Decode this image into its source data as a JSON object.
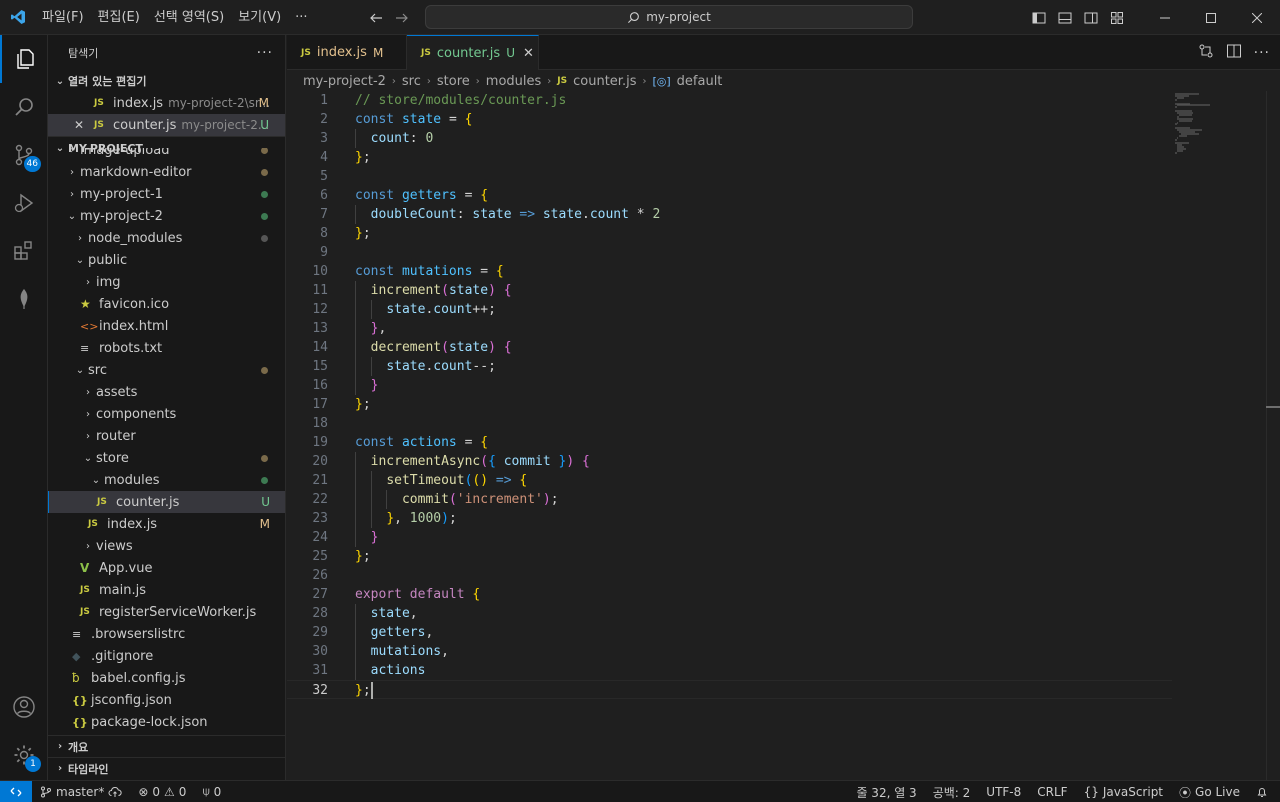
{
  "titlebar": {
    "menus": [
      "파일(F)",
      "편집(E)",
      "선택 영역(S)",
      "보기(V)",
      "···"
    ],
    "search_text": "my-project"
  },
  "activity": {
    "scm_badge": "46",
    "accounts_badge": "1"
  },
  "sidebar": {
    "title": "탐색기",
    "open_editors_label": "열려 있는 편집기",
    "open_editors": [
      {
        "name": "index.js",
        "path": "my-project-2\\sr...",
        "flag": "M"
      },
      {
        "name": "counter.js",
        "path": "my-project-2...",
        "flag": "U"
      }
    ],
    "project_label": "MY-PROJECT",
    "tree": [
      {
        "name": "image-upload",
        "flag": "dot"
      },
      {
        "name": "markdown-editor",
        "flag": "dot"
      },
      {
        "name": "my-project-1",
        "flag": "dot"
      },
      {
        "name": "my-project-2",
        "flag": "dot"
      },
      {
        "name": "node_modules",
        "flag": "dot"
      },
      {
        "name": "public"
      },
      {
        "name": "img"
      },
      {
        "name": "favicon.ico"
      },
      {
        "name": "index.html"
      },
      {
        "name": "robots.txt"
      },
      {
        "name": "src",
        "flag": "dot"
      },
      {
        "name": "assets"
      },
      {
        "name": "components"
      },
      {
        "name": "router"
      },
      {
        "name": "store",
        "flag": "dot"
      },
      {
        "name": "modules",
        "flag": "dot"
      },
      {
        "name": "counter.js",
        "flag": "U"
      },
      {
        "name": "index.js",
        "flag": "M"
      },
      {
        "name": "views"
      },
      {
        "name": "App.vue"
      },
      {
        "name": "main.js"
      },
      {
        "name": "registerServiceWorker.js"
      },
      {
        "name": ".browserslistrc"
      },
      {
        "name": ".gitignore"
      },
      {
        "name": "babel.config.js"
      },
      {
        "name": "jsconfig.json"
      },
      {
        "name": "package-lock.json"
      }
    ],
    "outline_label": "개요",
    "timeline_label": "타임라인"
  },
  "editor": {
    "tabs": [
      {
        "name": "index.js",
        "flag": "M"
      },
      {
        "name": "counter.js",
        "flag": "U"
      }
    ],
    "breadcrumb": [
      "my-project-2",
      "src",
      "store",
      "modules",
      "counter.js",
      "default"
    ],
    "lines": [
      "// store/modules/counter.js",
      "const state = {",
      "  count: 0",
      "};",
      "",
      "const getters = {",
      "  doubleCount: state => state.count * 2",
      "};",
      "",
      "const mutations = {",
      "  increment(state) {",
      "    state.count++;",
      "  },",
      "  decrement(state) {",
      "    state.count--;",
      "  }",
      "};",
      "",
      "const actions = {",
      "  incrementAsync({ commit }) {",
      "    setTimeout(() => {",
      "      commit('increment');",
      "    }, 1000);",
      "  }",
      "};",
      "",
      "export default {",
      "  state,",
      "  getters,",
      "  mutations,",
      "  actions",
      "};"
    ]
  },
  "status": {
    "branch": "master*",
    "errors": "0",
    "warnings": "0",
    "ports": "0",
    "position": "줄 32, 열 3",
    "spaces": "공백: 2",
    "encoding": "UTF-8",
    "eol": "CRLF",
    "language": "JavaScript",
    "golive": "Go Live"
  },
  "colors": {
    "accent": "#0078d4",
    "modified": "#e2c08d",
    "untracked": "#73c991",
    "js_icon": "#cbcb41"
  }
}
